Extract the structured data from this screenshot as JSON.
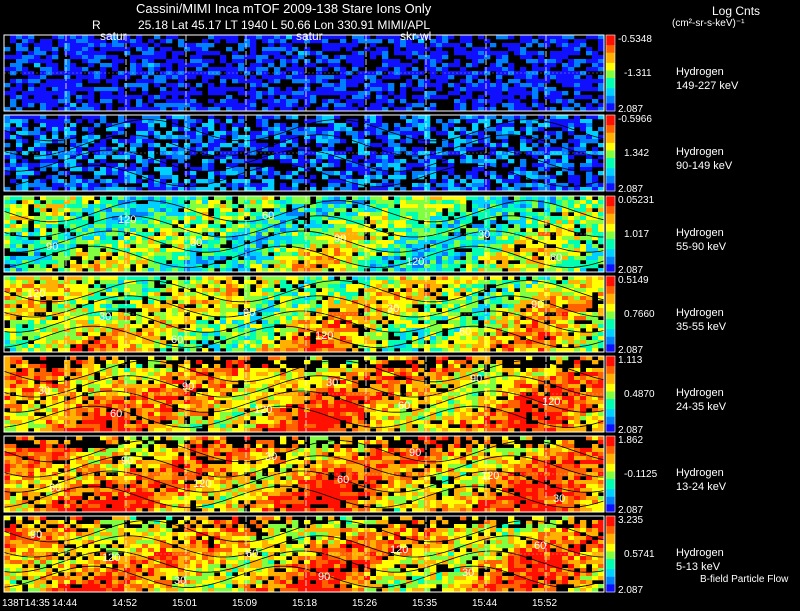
{
  "header": {
    "title": "Cassini/MIMI Inca mTOF  2009-138   Stare   Ions Only",
    "r_label": "R",
    "position_line": "25.18 Lat 45.17 LT 1940 L        50.66 Lon        330.91  MIMI/APL",
    "units_line1": "Log Cnts",
    "units_line2": "(cm²-sr-s-keV)⁻¹",
    "markers": [
      "satur",
      "satur",
      "skr-wl"
    ]
  },
  "footer_note": "B-field Particle Flow",
  "chart_data": {
    "type": "heatmap",
    "title": "Cassini/MIMI Inca mTOF  2009-138   Stare   Ions Only",
    "x_ticks": [
      "138T14:35",
      "14:44",
      "14:52",
      "15:01",
      "15:09",
      "15:18",
      "15:26",
      "15:35",
      "15:44",
      "15:52"
    ],
    "contour_labels": [
      "30",
      "60",
      "90",
      "120"
    ],
    "colors": {
      "scale": [
        "#1010ff",
        "#0080ff",
        "#00d0ff",
        "#00ffb0",
        "#80ff40",
        "#ffff00",
        "#ffb000",
        "#ff6000",
        "#ff1000"
      ],
      "empty": "#000000"
    },
    "panels": [
      {
        "species": "Hydrogen",
        "energy": "149-227 keV",
        "cmax": "-0.5348",
        "cmid": "-1.311",
        "cmin": "2.087",
        "level": 0.05
      },
      {
        "species": "Hydrogen",
        "energy": "90-149 keV",
        "cmax": "-0.5966",
        "cmid": "1.342",
        "cmin": "2.087",
        "level": 0.15
      },
      {
        "species": "Hydrogen",
        "energy": "55-90 keV",
        "cmax": "0.05231",
        "cmid": "1.017",
        "cmin": "2.087",
        "level": 0.42
      },
      {
        "species": "Hydrogen",
        "energy": "35-55 keV",
        "cmax": "0.5149",
        "cmid": "0.7660",
        "cmin": "2.087",
        "level": 0.55
      },
      {
        "species": "Hydrogen",
        "energy": "24-35 keV",
        "cmax": "1.113",
        "cmid": "0.4870",
        "cmin": "2.087",
        "level": 0.7
      },
      {
        "species": "Hydrogen",
        "energy": "13-24 keV",
        "cmax": "1.862",
        "cmid": "-0.1125",
        "cmin": "2.087",
        "level": 0.72
      },
      {
        "species": "Hydrogen",
        "energy": "5-13 keV",
        "cmax": "3.235",
        "cmid": "0.5741",
        "cmin": "2.087",
        "level": 0.68
      }
    ]
  }
}
